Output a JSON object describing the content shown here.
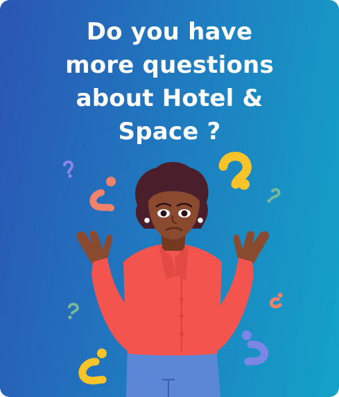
{
  "promo": {
    "headline_lines": [
      "Do you have",
      "more questions",
      "about Hotel &",
      "Space ?"
    ]
  },
  "colors": {
    "gradient_start": "#2a55b4",
    "gradient_end": "#13a3c8",
    "shirt": "#f4544e",
    "skin": "#8a4a2f",
    "hair": "#4a1f2b",
    "jeans": "#5c87d6",
    "qmark_yellow": "#f8c42a",
    "qmark_salmon": "#f2826c",
    "qmark_purple": "#7b86e6",
    "qmark_green": "#77b89c"
  },
  "icons": [
    "question-mark-icon",
    "thinking-person-illustration"
  ]
}
